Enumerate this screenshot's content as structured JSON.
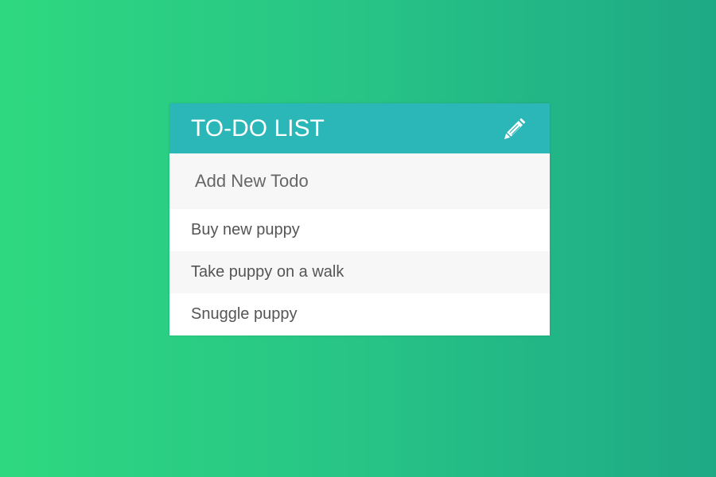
{
  "header": {
    "title": "TO-DO LIST",
    "edit_icon": "pencil-icon",
    "accent_color": "#2bb6b8"
  },
  "new_todo": {
    "placeholder": "Add New Todo",
    "value": ""
  },
  "todos": [
    {
      "label": "Buy new puppy"
    },
    {
      "label": "Take puppy on a walk"
    },
    {
      "label": "Snuggle puppy"
    }
  ],
  "background": {
    "gradient_start": "#2ed880",
    "gradient_end": "#1ea985"
  }
}
